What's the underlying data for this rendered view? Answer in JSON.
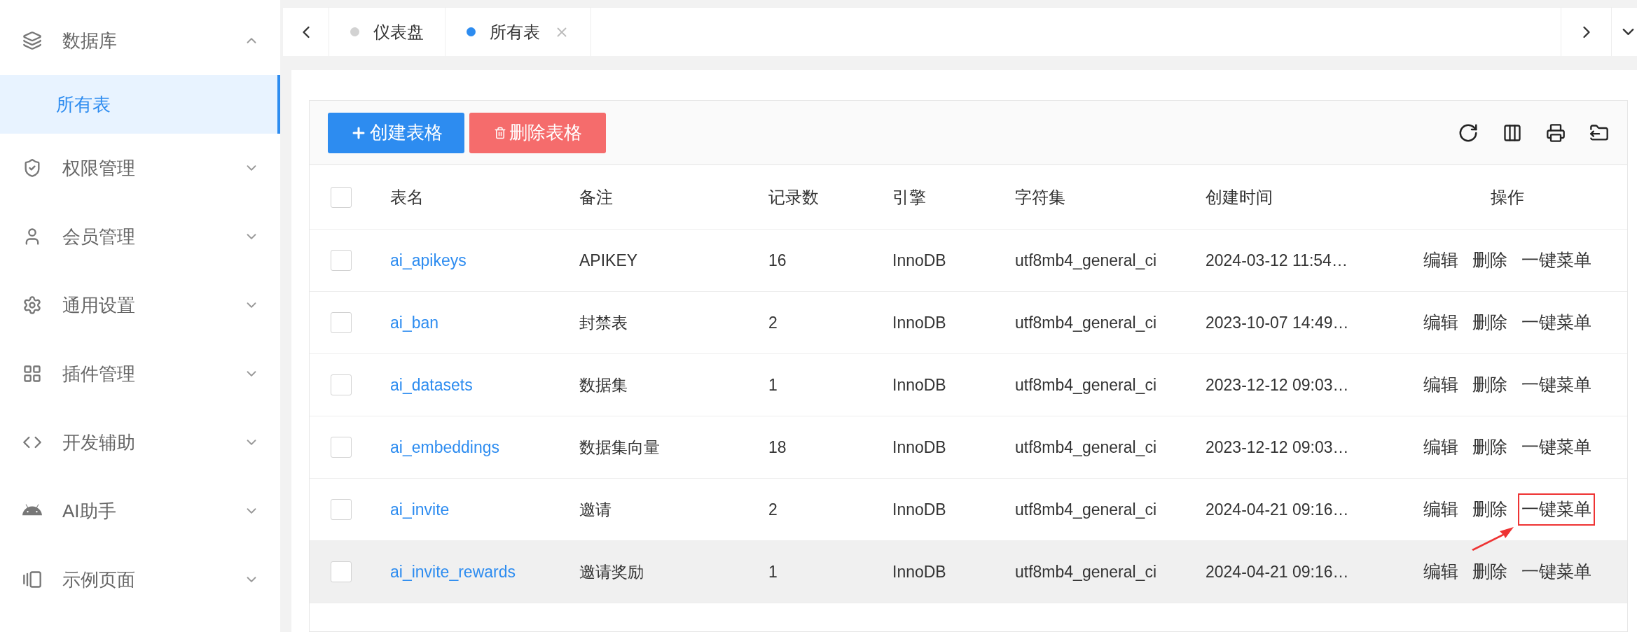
{
  "sidebar": {
    "items": [
      {
        "label": "数据库",
        "expanded": true,
        "children": [
          {
            "label": "所有表",
            "selected": true
          }
        ]
      },
      {
        "label": "权限管理",
        "expanded": false
      },
      {
        "label": "会员管理",
        "expanded": false
      },
      {
        "label": "通用设置",
        "expanded": false
      },
      {
        "label": "插件管理",
        "expanded": false
      },
      {
        "label": "开发辅助",
        "expanded": false
      },
      {
        "label": "AI助手",
        "expanded": false
      },
      {
        "label": "示例页面",
        "expanded": false
      }
    ]
  },
  "tabs": [
    {
      "label": "仪表盘",
      "selected": false,
      "closable": false
    },
    {
      "label": "所有表",
      "selected": true,
      "closable": true
    }
  ],
  "toolbar": {
    "buttons": [
      {
        "kind": "create",
        "label": "创建表格"
      },
      {
        "kind": "delete",
        "label": "删除表格"
      }
    ]
  },
  "table": {
    "select_all_checked": false,
    "columns": [
      "表名",
      "备注",
      "记录数",
      "引擎",
      "字符集",
      "创建时间",
      "操作"
    ],
    "rows": [
      {
        "checked": false,
        "hovered": false,
        "cells": [
          "ai_apikeys",
          "APIKEY",
          "16",
          "InnoDB",
          "utf8mb4_general_ci",
          "2024-03-12 11:54…"
        ],
        "actions": [
          {
            "label": "编辑",
            "highlighted": false
          },
          {
            "label": "删除",
            "highlighted": false
          },
          {
            "label": "一键菜单",
            "highlighted": false
          }
        ]
      },
      {
        "checked": false,
        "hovered": false,
        "cells": [
          "ai_ban",
          "封禁表",
          "2",
          "InnoDB",
          "utf8mb4_general_ci",
          "2023-10-07 14:49…"
        ],
        "actions": [
          {
            "label": "编辑",
            "highlighted": false
          },
          {
            "label": "删除",
            "highlighted": false
          },
          {
            "label": "一键菜单",
            "highlighted": false
          }
        ]
      },
      {
        "checked": false,
        "hovered": false,
        "cells": [
          "ai_datasets",
          "数据集",
          "1",
          "InnoDB",
          "utf8mb4_general_ci",
          "2023-12-12 09:03…"
        ],
        "actions": [
          {
            "label": "编辑",
            "highlighted": false
          },
          {
            "label": "删除",
            "highlighted": false
          },
          {
            "label": "一键菜单",
            "highlighted": false
          }
        ]
      },
      {
        "checked": false,
        "hovered": false,
        "cells": [
          "ai_embeddings",
          "数据集向量",
          "18",
          "InnoDB",
          "utf8mb4_general_ci",
          "2023-12-12 09:03…"
        ],
        "actions": [
          {
            "label": "编辑",
            "highlighted": false
          },
          {
            "label": "删除",
            "highlighted": false
          },
          {
            "label": "一键菜单",
            "highlighted": false
          }
        ]
      },
      {
        "checked": false,
        "hovered": false,
        "cells": [
          "ai_invite",
          "邀请",
          "2",
          "InnoDB",
          "utf8mb4_general_ci",
          "2024-04-21 09:16…"
        ],
        "actions": [
          {
            "label": "编辑",
            "highlighted": false
          },
          {
            "label": "删除",
            "highlighted": false
          },
          {
            "label": "一键菜单",
            "highlighted": true
          }
        ]
      },
      {
        "checked": false,
        "hovered": true,
        "cells": [
          "ai_invite_rewards",
          "邀请奖励",
          "1",
          "InnoDB",
          "utf8mb4_general_ci",
          "2024-04-21 09:16…"
        ],
        "actions": [
          {
            "label": "编辑",
            "highlighted": false
          },
          {
            "label": "删除",
            "highlighted": false
          },
          {
            "label": "一键菜单",
            "highlighted": false
          }
        ]
      }
    ]
  }
}
